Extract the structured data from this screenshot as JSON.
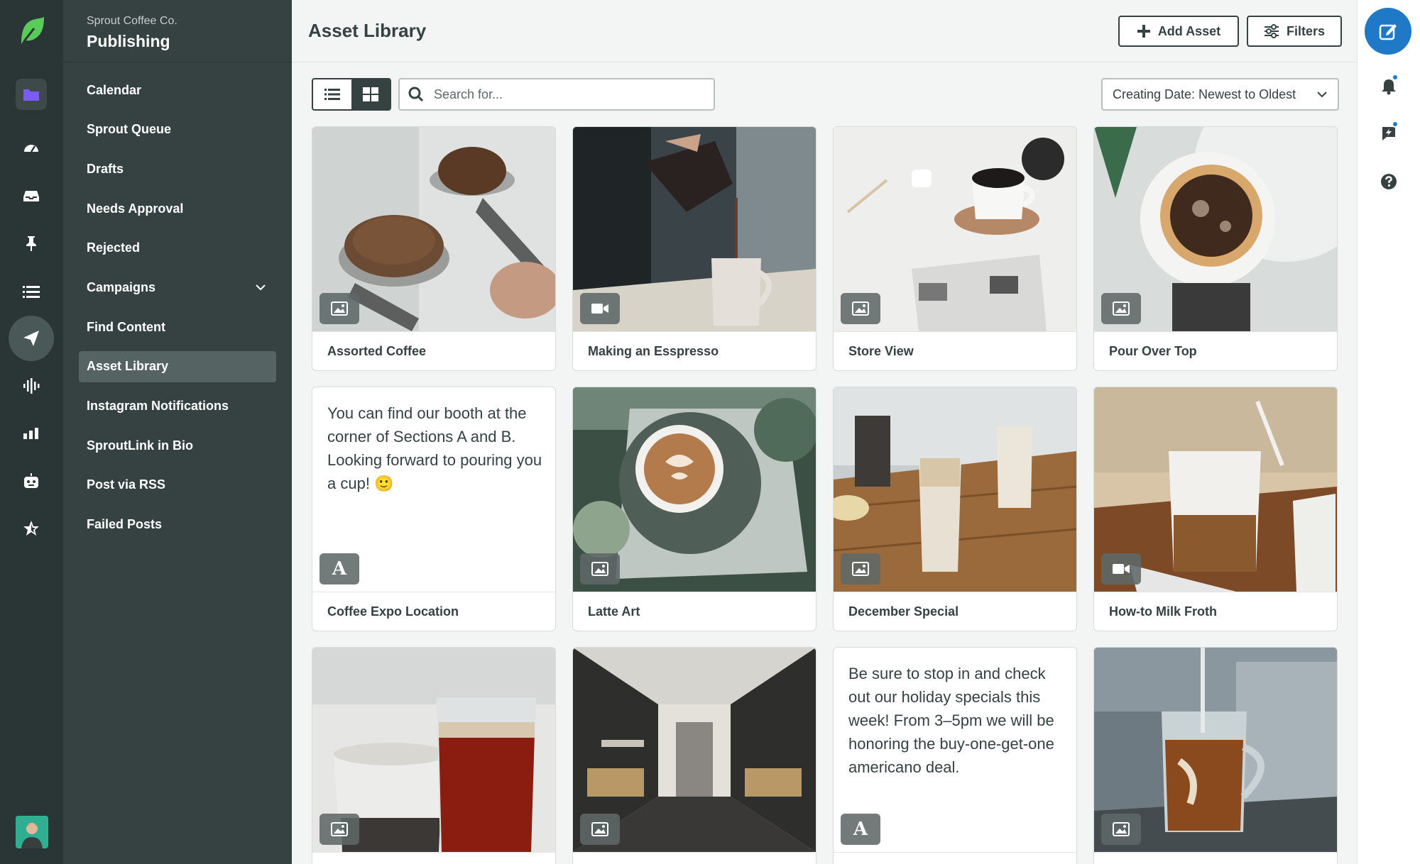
{
  "brand": {
    "accent": "#59cb59",
    "primary": "#2079c7"
  },
  "rail": {
    "icons": [
      "leaf-logo-icon",
      "folder-icon",
      "gauge-icon",
      "inbox-icon",
      "pin-icon",
      "list-icon",
      "paper-plane-icon",
      "audio-wave-icon",
      "bar-chart-icon",
      "bot-icon",
      "star-icon"
    ]
  },
  "nav": {
    "org": "Sprout Coffee Co.",
    "section": "Publishing",
    "items": [
      {
        "label": "Calendar"
      },
      {
        "label": "Sprout Queue"
      },
      {
        "label": "Drafts"
      },
      {
        "label": "Needs Approval"
      },
      {
        "label": "Rejected"
      },
      {
        "label": "Campaigns"
      },
      {
        "label": "Find Content"
      },
      {
        "label": "Asset Library"
      },
      {
        "label": "Instagram Notifications"
      },
      {
        "label": "SproutLink in Bio"
      },
      {
        "label": "Post via RSS"
      },
      {
        "label": "Failed Posts"
      }
    ]
  },
  "header": {
    "title": "Asset Library",
    "add_label": "Add Asset",
    "filters_label": "Filters"
  },
  "toolbar": {
    "search_placeholder": "Search for...",
    "sort_label": "Creating Date: Newest to Oldest"
  },
  "assets": [
    {
      "title": "Assorted Coffee",
      "type": "image"
    },
    {
      "title": "Making an Esspresso",
      "type": "video"
    },
    {
      "title": "Store View",
      "type": "image"
    },
    {
      "title": "Pour Over Top",
      "type": "image"
    },
    {
      "title": "Coffee Expo Location",
      "type": "text",
      "text": "You can find our booth at the corner of Sections A and B. Looking forward to pouring you a cup! 🙂",
      "badge": "A"
    },
    {
      "title": "Latte Art",
      "type": "image"
    },
    {
      "title": "December Special",
      "type": "image"
    },
    {
      "title": "How-to Milk Froth",
      "type": "video"
    },
    {
      "title": "",
      "type": "image"
    },
    {
      "title": "",
      "type": "image"
    },
    {
      "title": "",
      "type": "text",
      "text": "Be sure to stop in and check out our holiday specials this week! From 3–5pm we will be honoring the buy-one-get-one americano deal.",
      "badge": "A"
    },
    {
      "title": "",
      "type": "image"
    }
  ]
}
